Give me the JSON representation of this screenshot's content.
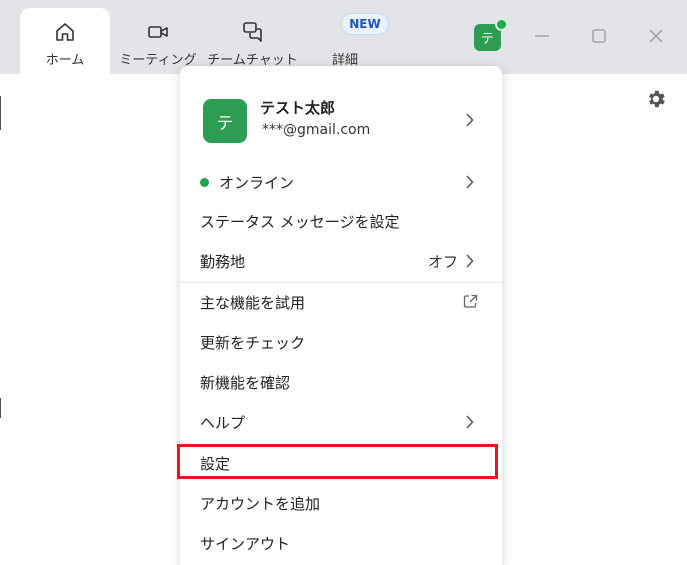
{
  "tabs": {
    "home": "ホーム",
    "meetings": "ミーティング",
    "team_chat": "チームチャット",
    "more": "詳細",
    "new_badge": "NEW"
  },
  "account": {
    "avatar_initial": "テ",
    "name": "テスト太郎",
    "email": "***@gmail.com",
    "status_color": "#1fa64a",
    "avatar_color": "#2d9d52"
  },
  "menu": {
    "status": "オンライン",
    "status_message": "ステータス メッセージを設定",
    "work_location": "勤務地",
    "work_location_value": "オフ",
    "try_features": "主な機能を試用",
    "check_updates": "更新をチェック",
    "whats_new": "新機能を確認",
    "help": "ヘルプ",
    "settings": "設定",
    "add_account": "アカウントを追加",
    "sign_out": "サインアウト"
  },
  "highlight_color": "#e01b1b"
}
